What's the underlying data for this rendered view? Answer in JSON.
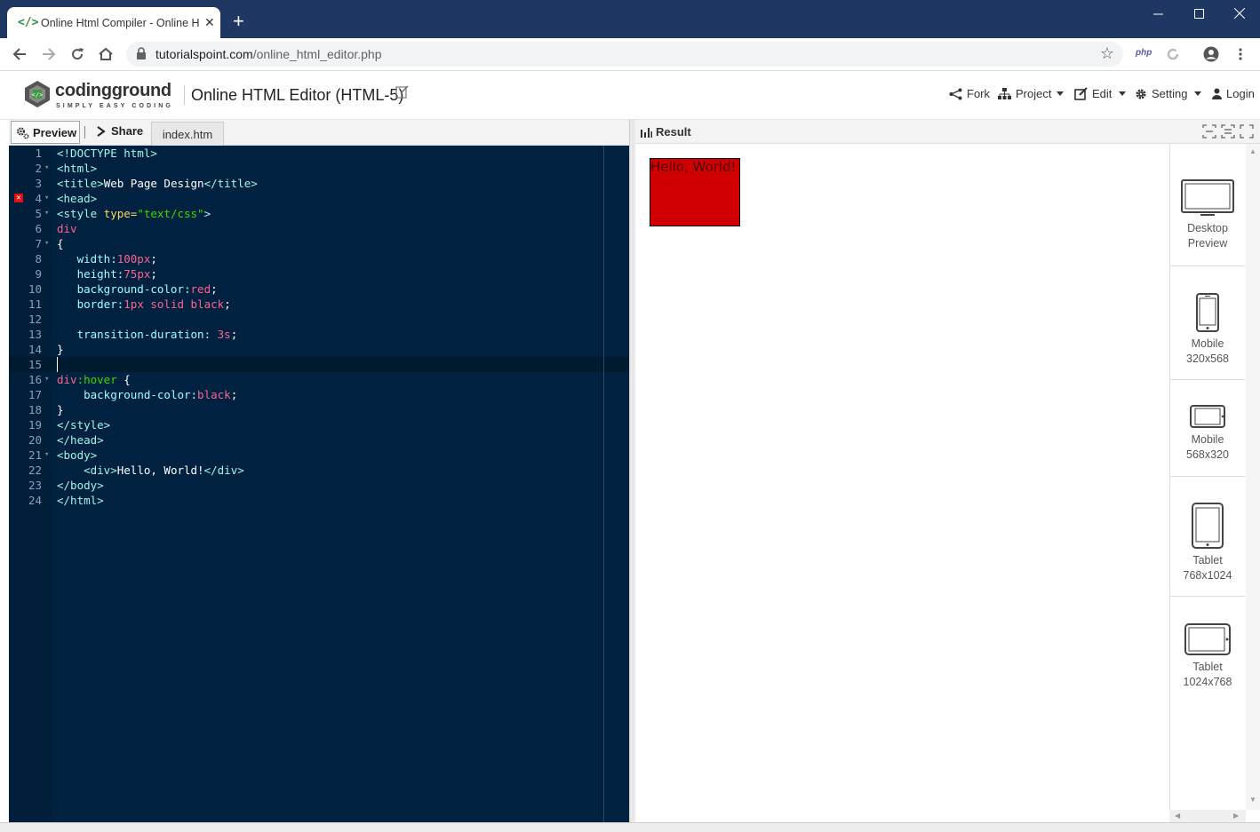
{
  "browser": {
    "tab_title": "Online Html Compiler - Online H",
    "url_host": "tutorialspoint.com",
    "url_path": "/online_html_editor.php",
    "extension_label": "php"
  },
  "header": {
    "logo_word": "codingground",
    "logo_tagline": "SIMPLY EASY CODING",
    "page_title": "Online HTML Editor (HTML-5)",
    "menu": {
      "fork": "Fork",
      "project": "Project",
      "edit": "Edit",
      "setting": "Setting",
      "login": "Login"
    }
  },
  "editor_bar": {
    "preview": "Preview",
    "share": "Share",
    "file_tab": "index.htm"
  },
  "code_lines": [
    {
      "n": "1",
      "fold": false,
      "error": false
    },
    {
      "n": "2",
      "fold": true,
      "error": false
    },
    {
      "n": "3",
      "fold": false,
      "error": false
    },
    {
      "n": "4",
      "fold": true,
      "error": true
    },
    {
      "n": "5",
      "fold": true,
      "error": false
    },
    {
      "n": "6",
      "fold": false,
      "error": false
    },
    {
      "n": "7",
      "fold": true,
      "error": false
    },
    {
      "n": "8",
      "fold": false,
      "error": false
    },
    {
      "n": "9",
      "fold": false,
      "error": false
    },
    {
      "n": "10",
      "fold": false,
      "error": false
    },
    {
      "n": "11",
      "fold": false,
      "error": false
    },
    {
      "n": "12",
      "fold": false,
      "error": false
    },
    {
      "n": "13",
      "fold": false,
      "error": false
    },
    {
      "n": "14",
      "fold": false,
      "error": false
    },
    {
      "n": "15",
      "fold": false,
      "error": false
    },
    {
      "n": "16",
      "fold": true,
      "error": false
    },
    {
      "n": "17",
      "fold": false,
      "error": false
    },
    {
      "n": "18",
      "fold": false,
      "error": false
    },
    {
      "n": "19",
      "fold": false,
      "error": false
    },
    {
      "n": "20",
      "fold": false,
      "error": false
    },
    {
      "n": "21",
      "fold": true,
      "error": false
    },
    {
      "n": "22",
      "fold": false,
      "error": false
    },
    {
      "n": "23",
      "fold": false,
      "error": false
    },
    {
      "n": "24",
      "fold": false,
      "error": false
    }
  ],
  "code": {
    "l1": "<!DOCTYPE html>",
    "l2": "<html>",
    "l3_open": "<title>",
    "l3_text": "Web Page Design",
    "l3_close": "</title>",
    "l4": "<head>",
    "l5_open": "<style ",
    "l5_attr": "type=",
    "l5_val": "\"text/css\"",
    "l5_close": ">",
    "l6": "div",
    "l7": "{",
    "l8_prop": "width:",
    "l8_val": "100px",
    "l8_end": ";",
    "l9_prop": "height:",
    "l9_val": "75px",
    "l9_end": ";",
    "l10_prop": "background-color:",
    "l10_val": "red",
    "l10_end": ";",
    "l11_prop": "border:",
    "l11_val": "1px solid black",
    "l11_end": ";",
    "l13_prop": "transition-duration: ",
    "l13_val": "3s",
    "l13_end": ";",
    "l14": "}",
    "l16_sel": "div",
    "l16_pseudo": ":hover",
    "l16_brace": " {",
    "l17_prop": "background-color:",
    "l17_val": "black",
    "l17_end": ";",
    "l18": "}",
    "l19": "</style>",
    "l20": "</head>",
    "l21": "<body>",
    "l22_open": "<div>",
    "l22_text": "Hello, World!",
    "l22_close": "</div>",
    "l23": "</body>",
    "l24": "</html>"
  },
  "result": {
    "title": "Result",
    "output_text": "Hello, World!"
  },
  "devices": [
    {
      "line1": "Desktop",
      "line2": "Preview"
    },
    {
      "line1": "Mobile",
      "line2": "320x568"
    },
    {
      "line1": "Mobile",
      "line2": "568x320"
    },
    {
      "line1": "Tablet",
      "line2": "768x1024"
    },
    {
      "line1": "Tablet",
      "line2": "1024x768"
    }
  ],
  "colors": {
    "titlebar": "#1f3763",
    "editor_bg": "#002240",
    "demo_box": "#d10000"
  }
}
